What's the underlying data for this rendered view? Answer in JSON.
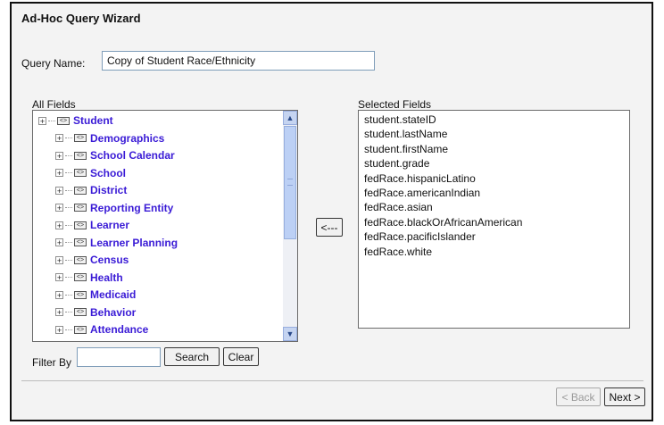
{
  "wizard": {
    "title": "Ad-Hoc Query Wizard"
  },
  "query": {
    "name_label": "Query Name:",
    "name_value": "Copy of Student Race/Ethnicity"
  },
  "all_fields": {
    "label": "All Fields",
    "root": "Student",
    "children": [
      "Demographics",
      "School Calendar",
      "School",
      "District",
      "Reporting Entity",
      "Learner",
      "Learner Planning",
      "Census",
      "Health",
      "Medicaid",
      "Behavior",
      "Attendance"
    ]
  },
  "selected_fields": {
    "label": "Selected Fields",
    "items": [
      "student.stateID",
      "student.lastName",
      "student.firstName",
      "student.grade",
      "fedRace.hispanicLatino",
      "fedRace.americanIndian",
      "fedRace.asian",
      "fedRace.blackOrAfricanAmerican",
      "fedRace.pacificIslander",
      "fedRace.white"
    ]
  },
  "buttons": {
    "remove": "<---",
    "search": "Search",
    "clear": "Clear",
    "back": "< Back",
    "next": "Next >"
  },
  "filter": {
    "label": "Filter By",
    "value": ""
  },
  "icons": {
    "expand": "plus-box-icon",
    "node": "xml-node-icon",
    "scroll_up": "chevron-up-icon",
    "scroll_down": "chevron-down-icon"
  },
  "colors": {
    "tree_link": "#3a1bd6",
    "frame_bg": "#f3f3f3"
  }
}
